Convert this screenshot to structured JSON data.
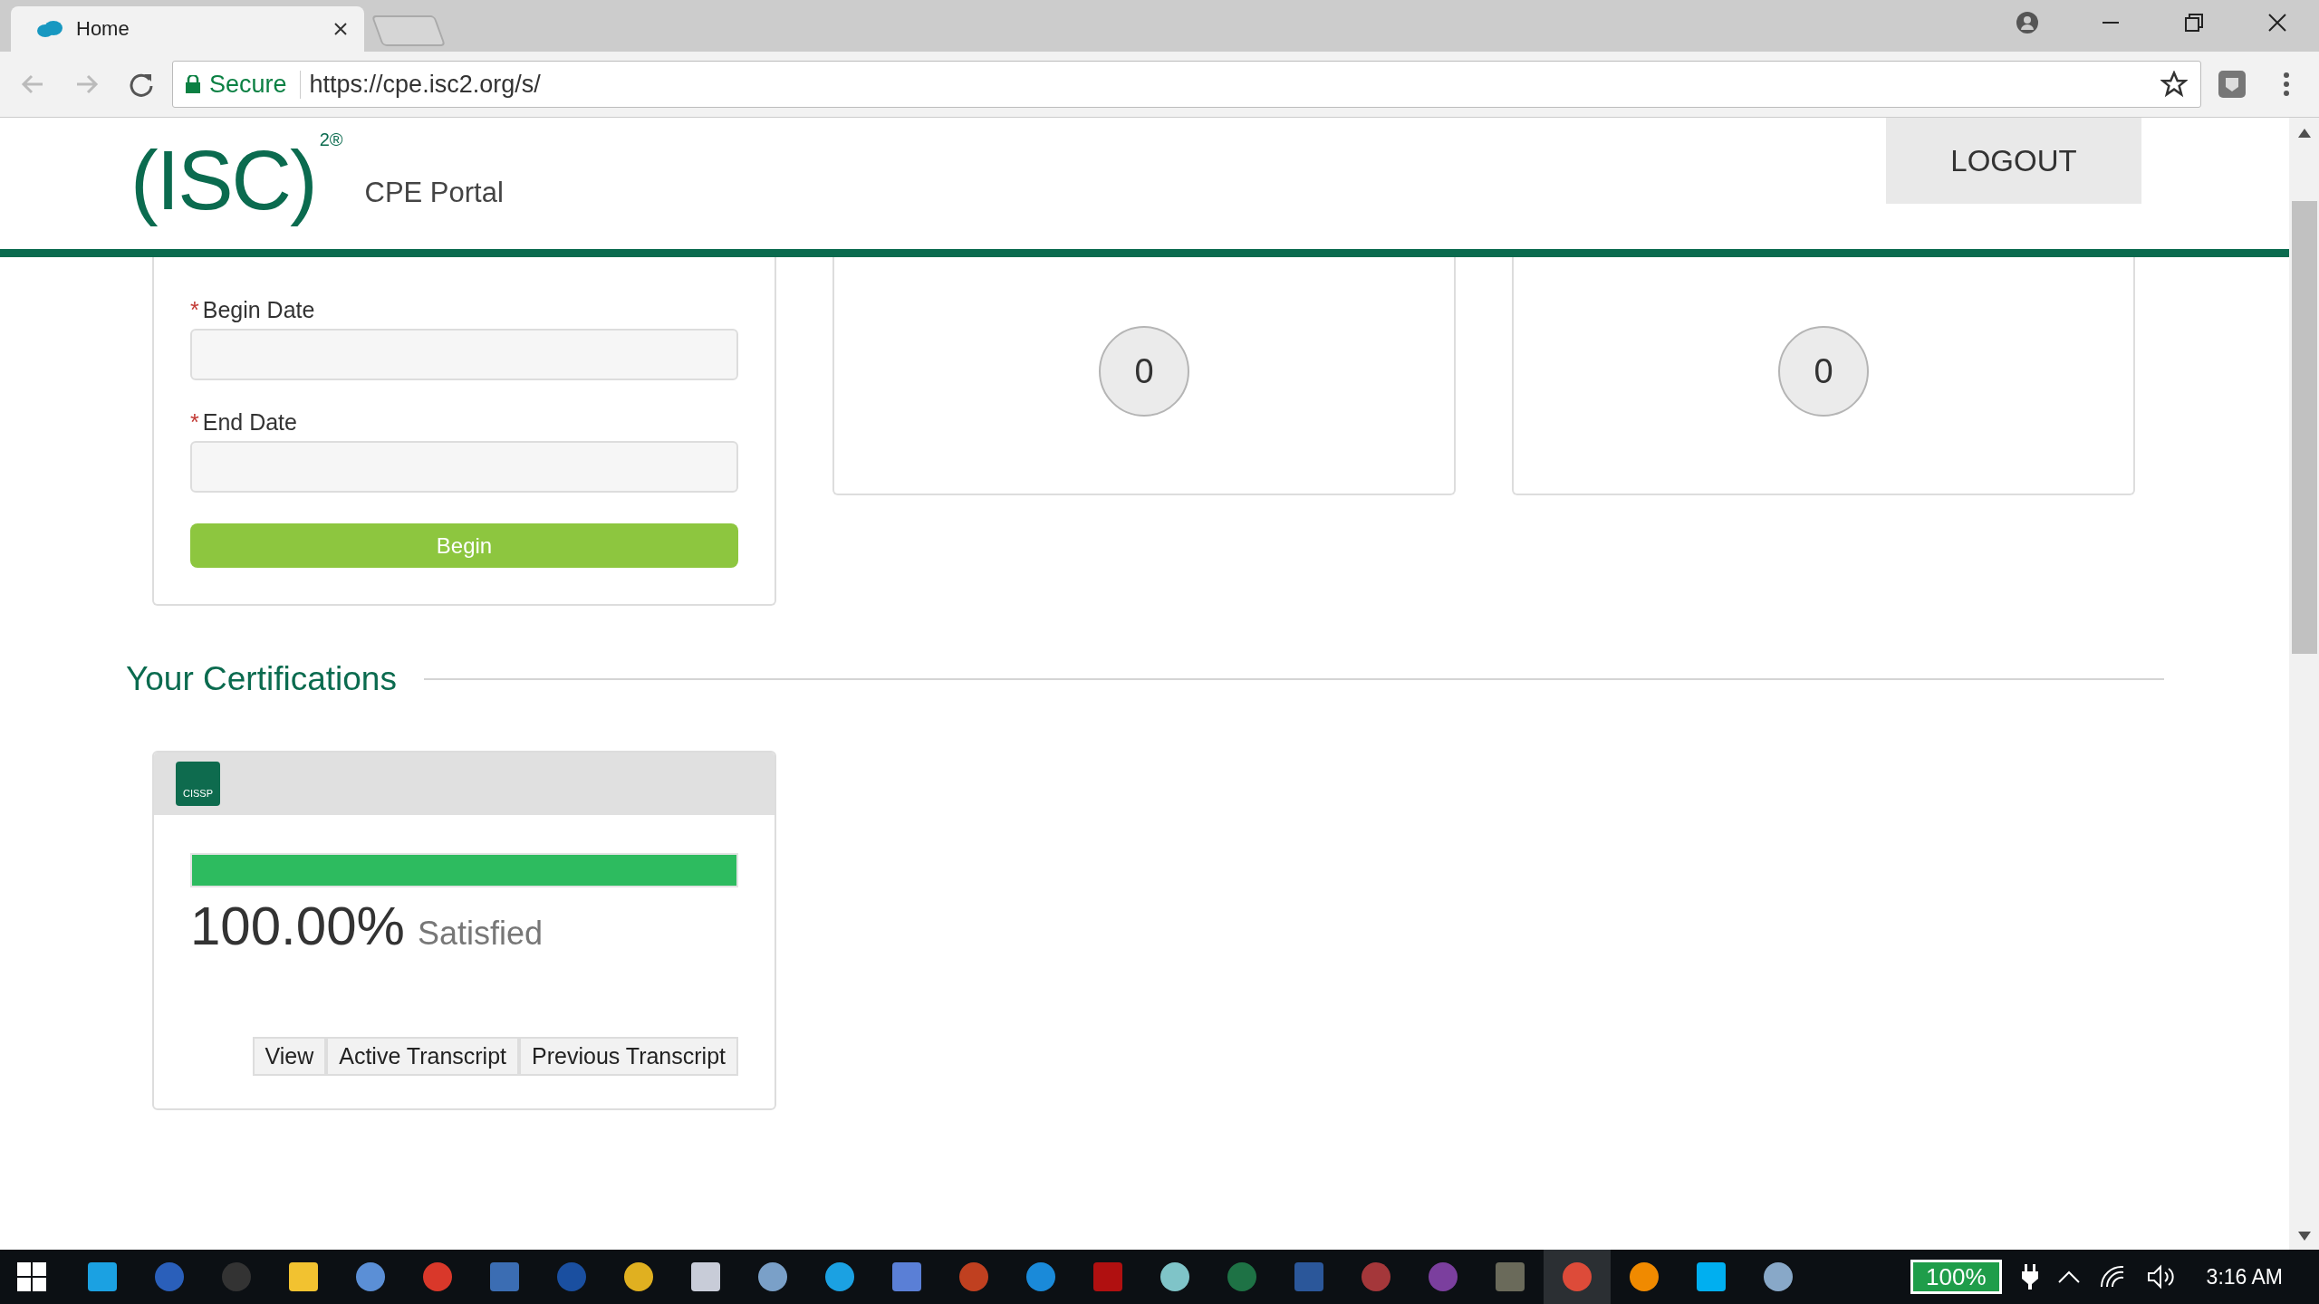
{
  "browser": {
    "tab": {
      "title": "Home",
      "selected": true
    },
    "security": "Secure",
    "url": "https://cpe.isc2.org/s/"
  },
  "header": {
    "logo": "(ISC)$^{2®}$",
    "portal": "CPE Portal",
    "logout": "LOGOUT"
  },
  "date_form": {
    "fields": [
      {
        "label": "Begin Date",
        "required_mark": "*"
      },
      {
        "label": "End Date",
        "required_mark": "*"
      }
    ],
    "submit": "Begin"
  },
  "counters": [
    {
      "value": "0"
    },
    {
      "value": "0"
    }
  ],
  "certifications": {
    "heading": "Your Certifications",
    "cards": [
      {
        "badge": "CISSP",
        "level": 1,
        "percent": "100.00%",
        "status": "Satisfied",
        "buttons": [
          "View",
          "Active Transcript",
          "Previous Transcript"
        ]
      }
    ]
  },
  "taskbar": {
    "apps": [
      {
        "selected": false
      },
      {
        "selected": false
      },
      {
        "selected": false
      },
      {
        "selected": false
      },
      {
        "selected": false
      },
      {
        "selected": false
      },
      {
        "selected": false
      },
      {
        "selected": false
      },
      {
        "selected": false
      },
      {
        "selected": false
      },
      {
        "selected": false
      },
      {
        "selected": false
      },
      {
        "selected": false
      },
      {
        "selected": false
      },
      {
        "selected": false
      },
      {
        "selected": false
      },
      {
        "selected": false
      },
      {
        "selected": false
      },
      {
        "selected": false
      },
      {
        "selected": false
      },
      {
        "selected": false
      },
      {
        "selected": false
      },
      {
        "selected": true
      },
      {
        "selected": false
      },
      {
        "selected": false
      },
      {
        "selected": false
      }
    ],
    "battery": "100%",
    "clock": "3:16 AM"
  }
}
